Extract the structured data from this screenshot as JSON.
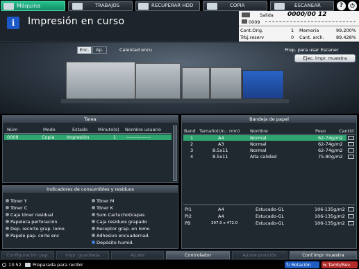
{
  "tabs": {
    "machine": "Máquina",
    "jobs": "TRABAJOS",
    "recall": "RECUPERAR HDD",
    "copy": "COPIA",
    "scan": "ESCANEAR"
  },
  "header": {
    "title": "Impresión en curso",
    "salida_label": "Salida",
    "salida_value": "0000/00 12",
    "job_no": "0009",
    "cont_orig_label": "Cont.Orig.",
    "cont_orig_value": "1",
    "memoria_label": "Memoria",
    "memoria_value": "99.200%",
    "trbj_label": "Trbj.reserv",
    "trbj_value": "0",
    "cant_arch_label": "Cant. arch.",
    "cant_arch_value": "89.428%"
  },
  "machine": {
    "enc": "Enc.",
    "ap": "Ap.",
    "heating": "Calentad encu",
    "scan_ready": "Prep. para usar Escaner",
    "scan_button": "Ejec. impr. muestra"
  },
  "task": {
    "title": "Tarea",
    "cols": [
      "Núm",
      "Modo",
      "Estado",
      "Minuto(s)",
      "Nombre usuario"
    ],
    "rows": [
      [
        "0009",
        "Copia",
        "Impresión",
        "1",
        "---------------"
      ]
    ]
  },
  "tray": {
    "title": "Bandeja de papel",
    "cols": [
      "Band",
      "Tamaño(Un.: mm)",
      "Nombre",
      "Peso",
      "Cantid"
    ],
    "rows": [
      [
        "1",
        "A4",
        "Normal",
        "62-74g/m2"
      ],
      [
        "2",
        "A3",
        "Normal",
        "62-74g/m2"
      ],
      [
        "3",
        "8.5x11",
        "Normal",
        "62-74g/m2"
      ],
      [
        "4",
        "8.5x11",
        "Alta calidad",
        "75-80g/m2"
      ]
    ],
    "pi_rows": [
      [
        "PI1",
        "A4",
        "Estucado-GL",
        "106-135g/m2"
      ],
      [
        "PI2",
        "A4",
        "Estucado-GL",
        "106-135g/m2"
      ],
      [
        "PB",
        "307.0 x 472.0",
        "Estucado-GL",
        "106-135g/m2"
      ]
    ]
  },
  "consumables": {
    "title": "Indicadores de consumibles y residuos",
    "left": [
      "Tóner Y",
      "Tóner C",
      "Caja tóner residual",
      "Papelera perforación",
      "Dep. recorte grap. lomo",
      "Papele pap. corte enc"
    ],
    "right": [
      "Tóner M",
      "Tóner K",
      "Sum.CartuchoGrapas",
      "Caja residuos grapado",
      "Receptor grap. en lomo",
      "Adhesivo encuadernad.",
      "Depósito humid."
    ]
  },
  "footer": {
    "config": "Configuración pap.",
    "hold": "Impr. guardada",
    "adjust": "Ajuste",
    "controller": "Controlador",
    "adjust_pos": "Ajuste posición",
    "sample": "Conf.impr muestra",
    "rotation": "Rotación",
    "tamb": "Tamb/Rev."
  },
  "status": {
    "time": "13:52",
    "message": "Preparada para recibir"
  }
}
